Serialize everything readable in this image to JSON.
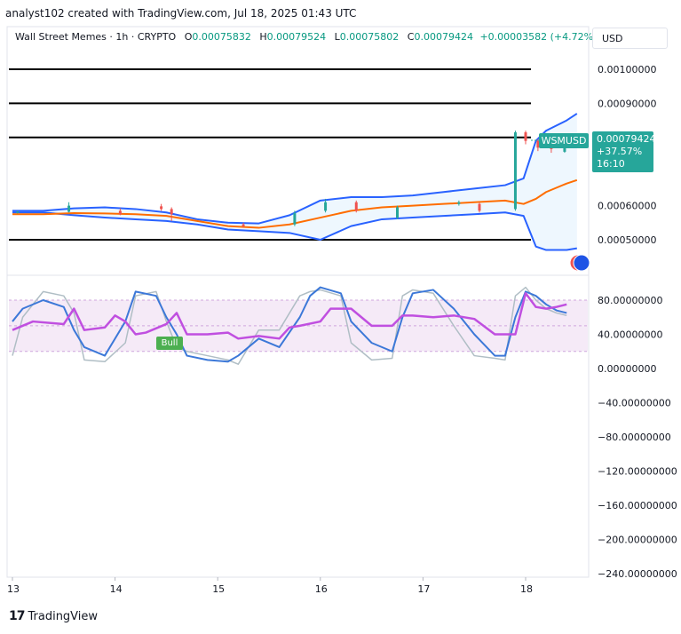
{
  "header": {
    "credit": "analyst102 created with TradingView.com, Jul 18, 2025 01:43 UTC",
    "symbol": "Wall Street Memes · 1h · CRYPTO",
    "open_label": "O",
    "open": "0.00075832",
    "high_label": "H",
    "high": "0.00079524",
    "low_label": "L",
    "low": "0.00075802",
    "close_label": "C",
    "close": "0.00079424",
    "change": "+0.00003582 (+4.72%)",
    "currency": "USD"
  },
  "price_tag": {
    "ticker": "WSMUSD",
    "price": "0.00079424",
    "change_pct": "+37.57%",
    "countdown": "16:10"
  },
  "footer": {
    "brand": "TradingView",
    "logo": "17"
  },
  "colors": {
    "up": "#26a69a",
    "down": "#ef5350",
    "bollinger": "#2962ff",
    "basis": "#ff6d00",
    "stoch_k": "#3c78d8",
    "stoch_d": "#b0bec5",
    "rsi": "#c04fe0",
    "band_fill": "#f3e5f5",
    "bull_label": "#4caf50"
  },
  "chart_data": [
    {
      "type": "line",
      "title": "Wall Street Memes · 1h · CRYPTO",
      "y_tick_labels": [
        "0.00100000",
        "0.00090000",
        "0.00060000",
        "0.00050000"
      ],
      "ylim": [
        0.00044,
        0.00105
      ],
      "x_tick_labels": [
        "13",
        "14",
        "15",
        "16",
        "17",
        "18"
      ],
      "horizontal_lines": [
        0.001,
        0.0009,
        0.0008,
        0.0005
      ],
      "series": [
        {
          "x": [
            0,
            0.3,
            0.6,
            0.9,
            1.2,
            1.5,
            1.8,
            2.1,
            2.4,
            2.7,
            3.0,
            3.3,
            3.6,
            3.9,
            4.2,
            4.5,
            4.8,
            4.98,
            5.1,
            5.2,
            5.4,
            5.5
          ],
          "values": [
            0.000585,
            0.000585,
            0.000592,
            0.000595,
            0.00059,
            0.00058,
            0.00056,
            0.00055,
            0.000548,
            0.000572,
            0.000615,
            0.000625,
            0.000625,
            0.00063,
            0.00064,
            0.00065,
            0.00066,
            0.00068,
            0.00079,
            0.00082,
            0.00085,
            0.00087
          ]
        },
        {
          "x": [
            0,
            0.3,
            0.6,
            0.9,
            1.2,
            1.5,
            1.8,
            2.1,
            2.4,
            2.7,
            3.0,
            3.3,
            3.6,
            3.9,
            4.2,
            4.5,
            4.8,
            4.98,
            5.1,
            5.2,
            5.4,
            5.5
          ],
          "values": [
            0.000575,
            0.000575,
            0.000578,
            0.000577,
            0.000575,
            0.00057,
            0.000555,
            0.00054,
            0.000535,
            0.000545,
            0.000565,
            0.000585,
            0.000595,
            0.0006,
            0.000605,
            0.00061,
            0.000615,
            0.000605,
            0.00062,
            0.00064,
            0.000665,
            0.000675
          ]
        },
        {
          "x": [
            0,
            0.3,
            0.6,
            0.9,
            1.2,
            1.5,
            1.8,
            2.1,
            2.4,
            2.7,
            3.0,
            3.3,
            3.6,
            3.9,
            4.2,
            4.5,
            4.8,
            4.98,
            5.1,
            5.2,
            5.4,
            5.5
          ],
          "values": [
            0.00058,
            0.00058,
            0.000572,
            0.000565,
            0.00056,
            0.000555,
            0.000545,
            0.00053,
            0.000525,
            0.00052,
            0.0005,
            0.00054,
            0.00056,
            0.000565,
            0.00057,
            0.000575,
            0.00058,
            0.00057,
            0.00048,
            0.00047,
            0.00047,
            0.000475
          ]
        }
      ],
      "candles": [
        {
          "x": 0.05,
          "o": 0.00058,
          "c": 0.000583,
          "h": 0.000585,
          "l": 0.000577
        },
        {
          "x": 0.55,
          "o": 0.000582,
          "c": 0.0006,
          "h": 0.00061,
          "l": 0.00058
        },
        {
          "x": 1.05,
          "o": 0.000585,
          "c": 0.000575,
          "h": 0.000592,
          "l": 0.000572
        },
        {
          "x": 1.45,
          "o": 0.000598,
          "c": 0.00059,
          "h": 0.000605,
          "l": 0.000585
        },
        {
          "x": 1.55,
          "o": 0.00059,
          "c": 0.000575,
          "h": 0.000595,
          "l": 0.000555
        },
        {
          "x": 2.25,
          "o": 0.000545,
          "c": 0.00054,
          "h": 0.00055,
          "l": 0.000535
        },
        {
          "x": 2.75,
          "o": 0.000545,
          "c": 0.000578,
          "h": 0.000585,
          "l": 0.00054
        },
        {
          "x": 3.05,
          "o": 0.000585,
          "c": 0.00061,
          "h": 0.00062,
          "l": 0.00058
        },
        {
          "x": 3.35,
          "o": 0.00061,
          "c": 0.000585,
          "h": 0.000615,
          "l": 0.00058
        },
        {
          "x": 3.75,
          "o": 0.000565,
          "c": 0.000595,
          "h": 0.0006,
          "l": 0.00056
        },
        {
          "x": 4.35,
          "o": 0.000605,
          "c": 0.00061,
          "h": 0.000615,
          "l": 0.0006
        },
        {
          "x": 4.55,
          "o": 0.000605,
          "c": 0.000585,
          "h": 0.00061,
          "l": 0.00058
        },
        {
          "x": 4.9,
          "o": 0.00059,
          "c": 0.000815,
          "h": 0.00082,
          "l": 0.000585
        },
        {
          "x": 5.0,
          "o": 0.000815,
          "c": 0.00079,
          "h": 0.00082,
          "l": 0.00078
        },
        {
          "x": 5.12,
          "o": 0.00079,
          "c": 0.00077,
          "h": 0.000795,
          "l": 0.00076
        },
        {
          "x": 5.25,
          "o": 0.00077,
          "c": 0.000768,
          "h": 0.00078,
          "l": 0.000755
        },
        {
          "x": 5.38,
          "o": 0.000758,
          "c": 0.000794,
          "h": 0.000795,
          "l": 0.000755
        }
      ]
    },
    {
      "type": "line",
      "y_tick_labels": [
        "80.00000000",
        "40.00000000",
        "0.00000000",
        "−40.00000000",
        "−80.00000000",
        "−120.00000000",
        "−160.00000000",
        "−200.00000000",
        "−240.00000000"
      ],
      "ylim": [
        -245,
        110
      ],
      "x_tick_labels": [
        "13",
        "14",
        "15",
        "16",
        "17",
        "18"
      ],
      "band": [
        20,
        80
      ],
      "annotation": "Bull",
      "series": [
        {
          "x": [
            0,
            0.1,
            0.3,
            0.5,
            0.6,
            0.7,
            0.9,
            1.1,
            1.2,
            1.4,
            1.5,
            1.6,
            1.7,
            1.9,
            2.1,
            2.2,
            2.4,
            2.6,
            2.8,
            2.9,
            3.0,
            3.2,
            3.3,
            3.5,
            3.7,
            3.8,
            3.9,
            4.1,
            4.3,
            4.5,
            4.7,
            4.8,
            4.9,
            5.0,
            5.1,
            5.2,
            5.3,
            5.4
          ],
          "values": [
            55,
            70,
            80,
            72,
            45,
            25,
            15,
            55,
            90,
            85,
            60,
            40,
            15,
            10,
            8,
            15,
            35,
            25,
            60,
            85,
            95,
            88,
            55,
            30,
            20,
            60,
            88,
            92,
            70,
            40,
            15,
            15,
            60,
            90,
            85,
            75,
            68,
            65
          ]
        },
        {
          "x": [
            0,
            0.1,
            0.3,
            0.5,
            0.6,
            0.7,
            0.9,
            1.1,
            1.2,
            1.4,
            1.5,
            1.6,
            1.7,
            1.9,
            2.1,
            2.2,
            2.4,
            2.6,
            2.8,
            2.9,
            3.0,
            3.2,
            3.3,
            3.5,
            3.7,
            3.8,
            3.9,
            4.1,
            4.3,
            4.5,
            4.7,
            4.8,
            4.9,
            5.0,
            5.1,
            5.2,
            5.3,
            5.4
          ],
          "values": [
            15,
            60,
            90,
            85,
            65,
            10,
            8,
            30,
            85,
            90,
            55,
            25,
            20,
            15,
            10,
            5,
            45,
            45,
            85,
            90,
            92,
            85,
            30,
            10,
            12,
            85,
            92,
            88,
            50,
            15,
            12,
            10,
            85,
            95,
            80,
            70,
            65,
            62
          ]
        },
        {
          "x": [
            0,
            0.2,
            0.5,
            0.6,
            0.7,
            0.9,
            1.0,
            1.1,
            1.2,
            1.3,
            1.5,
            1.6,
            1.7,
            1.9,
            2.1,
            2.2,
            2.4,
            2.6,
            2.7,
            2.8,
            3.0,
            3.1,
            3.3,
            3.5,
            3.7,
            3.8,
            3.9,
            4.1,
            4.3,
            4.5,
            4.7,
            4.8,
            4.9,
            5.0,
            5.1,
            5.2,
            5.3,
            5.4
          ],
          "values": [
            45,
            55,
            52,
            70,
            45,
            48,
            62,
            55,
            40,
            42,
            52,
            65,
            40,
            40,
            42,
            35,
            38,
            35,
            48,
            50,
            55,
            70,
            70,
            50,
            50,
            62,
            62,
            60,
            62,
            58,
            40,
            40,
            40,
            88,
            72,
            70,
            72,
            75
          ]
        }
      ]
    }
  ]
}
